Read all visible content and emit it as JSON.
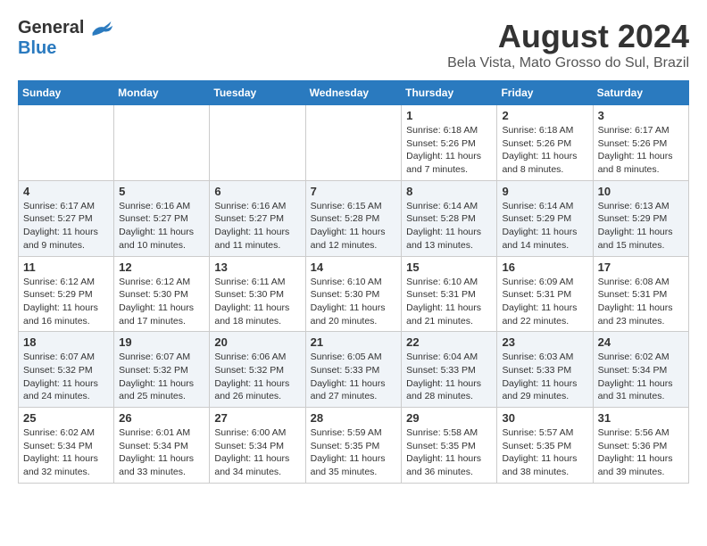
{
  "header": {
    "logo_general": "General",
    "logo_blue": "Blue",
    "main_title": "August 2024",
    "subtitle": "Bela Vista, Mato Grosso do Sul, Brazil"
  },
  "calendar": {
    "days_of_week": [
      "Sunday",
      "Monday",
      "Tuesday",
      "Wednesday",
      "Thursday",
      "Friday",
      "Saturday"
    ],
    "weeks": [
      [
        {
          "day": "",
          "info": ""
        },
        {
          "day": "",
          "info": ""
        },
        {
          "day": "",
          "info": ""
        },
        {
          "day": "",
          "info": ""
        },
        {
          "day": "1",
          "info": "Sunrise: 6:18 AM\nSunset: 5:26 PM\nDaylight: 11 hours and 7 minutes."
        },
        {
          "day": "2",
          "info": "Sunrise: 6:18 AM\nSunset: 5:26 PM\nDaylight: 11 hours and 8 minutes."
        },
        {
          "day": "3",
          "info": "Sunrise: 6:17 AM\nSunset: 5:26 PM\nDaylight: 11 hours and 8 minutes."
        }
      ],
      [
        {
          "day": "4",
          "info": "Sunrise: 6:17 AM\nSunset: 5:27 PM\nDaylight: 11 hours and 9 minutes."
        },
        {
          "day": "5",
          "info": "Sunrise: 6:16 AM\nSunset: 5:27 PM\nDaylight: 11 hours and 10 minutes."
        },
        {
          "day": "6",
          "info": "Sunrise: 6:16 AM\nSunset: 5:27 PM\nDaylight: 11 hours and 11 minutes."
        },
        {
          "day": "7",
          "info": "Sunrise: 6:15 AM\nSunset: 5:28 PM\nDaylight: 11 hours and 12 minutes."
        },
        {
          "day": "8",
          "info": "Sunrise: 6:14 AM\nSunset: 5:28 PM\nDaylight: 11 hours and 13 minutes."
        },
        {
          "day": "9",
          "info": "Sunrise: 6:14 AM\nSunset: 5:29 PM\nDaylight: 11 hours and 14 minutes."
        },
        {
          "day": "10",
          "info": "Sunrise: 6:13 AM\nSunset: 5:29 PM\nDaylight: 11 hours and 15 minutes."
        }
      ],
      [
        {
          "day": "11",
          "info": "Sunrise: 6:12 AM\nSunset: 5:29 PM\nDaylight: 11 hours and 16 minutes."
        },
        {
          "day": "12",
          "info": "Sunrise: 6:12 AM\nSunset: 5:30 PM\nDaylight: 11 hours and 17 minutes."
        },
        {
          "day": "13",
          "info": "Sunrise: 6:11 AM\nSunset: 5:30 PM\nDaylight: 11 hours and 18 minutes."
        },
        {
          "day": "14",
          "info": "Sunrise: 6:10 AM\nSunset: 5:30 PM\nDaylight: 11 hours and 20 minutes."
        },
        {
          "day": "15",
          "info": "Sunrise: 6:10 AM\nSunset: 5:31 PM\nDaylight: 11 hours and 21 minutes."
        },
        {
          "day": "16",
          "info": "Sunrise: 6:09 AM\nSunset: 5:31 PM\nDaylight: 11 hours and 22 minutes."
        },
        {
          "day": "17",
          "info": "Sunrise: 6:08 AM\nSunset: 5:31 PM\nDaylight: 11 hours and 23 minutes."
        }
      ],
      [
        {
          "day": "18",
          "info": "Sunrise: 6:07 AM\nSunset: 5:32 PM\nDaylight: 11 hours and 24 minutes."
        },
        {
          "day": "19",
          "info": "Sunrise: 6:07 AM\nSunset: 5:32 PM\nDaylight: 11 hours and 25 minutes."
        },
        {
          "day": "20",
          "info": "Sunrise: 6:06 AM\nSunset: 5:32 PM\nDaylight: 11 hours and 26 minutes."
        },
        {
          "day": "21",
          "info": "Sunrise: 6:05 AM\nSunset: 5:33 PM\nDaylight: 11 hours and 27 minutes."
        },
        {
          "day": "22",
          "info": "Sunrise: 6:04 AM\nSunset: 5:33 PM\nDaylight: 11 hours and 28 minutes."
        },
        {
          "day": "23",
          "info": "Sunrise: 6:03 AM\nSunset: 5:33 PM\nDaylight: 11 hours and 29 minutes."
        },
        {
          "day": "24",
          "info": "Sunrise: 6:02 AM\nSunset: 5:34 PM\nDaylight: 11 hours and 31 minutes."
        }
      ],
      [
        {
          "day": "25",
          "info": "Sunrise: 6:02 AM\nSunset: 5:34 PM\nDaylight: 11 hours and 32 minutes."
        },
        {
          "day": "26",
          "info": "Sunrise: 6:01 AM\nSunset: 5:34 PM\nDaylight: 11 hours and 33 minutes."
        },
        {
          "day": "27",
          "info": "Sunrise: 6:00 AM\nSunset: 5:34 PM\nDaylight: 11 hours and 34 minutes."
        },
        {
          "day": "28",
          "info": "Sunrise: 5:59 AM\nSunset: 5:35 PM\nDaylight: 11 hours and 35 minutes."
        },
        {
          "day": "29",
          "info": "Sunrise: 5:58 AM\nSunset: 5:35 PM\nDaylight: 11 hours and 36 minutes."
        },
        {
          "day": "30",
          "info": "Sunrise: 5:57 AM\nSunset: 5:35 PM\nDaylight: 11 hours and 38 minutes."
        },
        {
          "day": "31",
          "info": "Sunrise: 5:56 AM\nSunset: 5:36 PM\nDaylight: 11 hours and 39 minutes."
        }
      ]
    ]
  }
}
